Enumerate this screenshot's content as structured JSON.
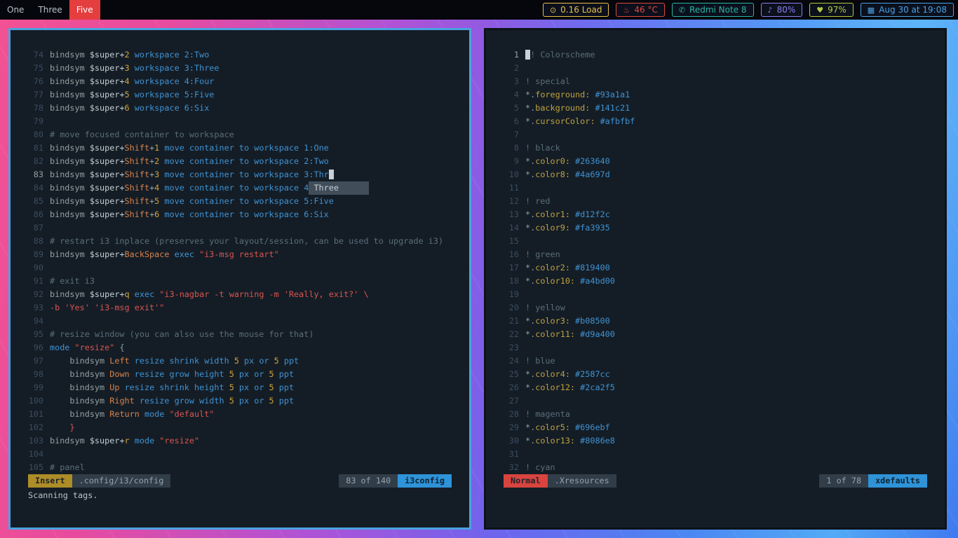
{
  "bar": {
    "workspaces": [
      {
        "label": "One",
        "active": false
      },
      {
        "label": "Three",
        "active": false
      },
      {
        "label": "Five",
        "active": true
      }
    ],
    "modules": [
      {
        "name": "load",
        "icon": "⊙",
        "label": "0.16 Load",
        "color": "#e8c04a"
      },
      {
        "name": "temp",
        "icon": "♨",
        "label": "46 °C",
        "color": "#e0473f"
      },
      {
        "name": "device",
        "icon": "✆",
        "label": "Redmi Note 8",
        "color": "#2ab5a5"
      },
      {
        "name": "volume",
        "icon": "♪",
        "label": "80%",
        "color": "#8b7ff0"
      },
      {
        "name": "battery",
        "icon": "♥",
        "label": "97%",
        "color": "#b5cb3f"
      },
      {
        "name": "date",
        "icon": "▦",
        "label": "Aug 30 at 19:08",
        "color": "#4aa3e8"
      }
    ]
  },
  "left_editor": {
    "statusline": {
      "mode": "Insert",
      "file": ".config/i3/config",
      "position": "83 of 140",
      "filetype": "i3config"
    },
    "cmdline": "Scanning tags.",
    "current_line": 83,
    "completion_popup": "Three",
    "lines": [
      {
        "n": 74,
        "t": [
          [
            "f",
            "bindsym "
          ],
          [
            "v",
            "$super+"
          ],
          [
            "n",
            "2"
          ],
          [
            "f",
            " "
          ],
          [
            "k",
            "workspace 2:Two"
          ]
        ]
      },
      {
        "n": 75,
        "t": [
          [
            "f",
            "bindsym "
          ],
          [
            "v",
            "$super+"
          ],
          [
            "n",
            "3"
          ],
          [
            "f",
            " "
          ],
          [
            "k",
            "workspace 3:Three"
          ]
        ]
      },
      {
        "n": 76,
        "t": [
          [
            "f",
            "bindsym "
          ],
          [
            "v",
            "$super+"
          ],
          [
            "n",
            "4"
          ],
          [
            "f",
            " "
          ],
          [
            "k",
            "workspace 4:Four"
          ]
        ]
      },
      {
        "n": 77,
        "t": [
          [
            "f",
            "bindsym "
          ],
          [
            "v",
            "$super+"
          ],
          [
            "n",
            "5"
          ],
          [
            "f",
            " "
          ],
          [
            "k",
            "workspace 5:Five"
          ]
        ]
      },
      {
        "n": 78,
        "t": [
          [
            "f",
            "bindsym "
          ],
          [
            "v",
            "$super+"
          ],
          [
            "n",
            "6"
          ],
          [
            "f",
            " "
          ],
          [
            "k",
            "workspace 6:Six"
          ]
        ]
      },
      {
        "n": 79,
        "t": []
      },
      {
        "n": 80,
        "t": [
          [
            "c",
            "# move focused container to workspace"
          ]
        ]
      },
      {
        "n": 81,
        "t": [
          [
            "f",
            "bindsym "
          ],
          [
            "v",
            "$super+"
          ],
          [
            "e",
            "Shift"
          ],
          [
            "f",
            "+"
          ],
          [
            "n",
            "1"
          ],
          [
            "f",
            " "
          ],
          [
            "k",
            "move container to workspace 1:One"
          ]
        ]
      },
      {
        "n": 82,
        "t": [
          [
            "f",
            "bindsym "
          ],
          [
            "v",
            "$super+"
          ],
          [
            "e",
            "Shift"
          ],
          [
            "f",
            "+"
          ],
          [
            "n",
            "2"
          ],
          [
            "f",
            " "
          ],
          [
            "k",
            "move container to workspace 2:Two"
          ]
        ]
      },
      {
        "n": 83,
        "t": [
          [
            "f",
            "bindsym "
          ],
          [
            "v",
            "$super+"
          ],
          [
            "e",
            "Shift"
          ],
          [
            "f",
            "+"
          ],
          [
            "n",
            "3"
          ],
          [
            "f",
            " "
          ],
          [
            "k",
            "move container to workspace 3:Thr"
          ],
          [
            "C",
            " "
          ]
        ]
      },
      {
        "n": 84,
        "t": [
          [
            "f",
            "bindsym "
          ],
          [
            "v",
            "$super+"
          ],
          [
            "e",
            "Shift"
          ],
          [
            "f",
            "+"
          ],
          [
            "n",
            "4"
          ],
          [
            "f",
            " "
          ],
          [
            "k",
            "move container to workspace 4"
          ],
          [
            "P",
            "Three"
          ]
        ]
      },
      {
        "n": 85,
        "t": [
          [
            "f",
            "bindsym "
          ],
          [
            "v",
            "$super+"
          ],
          [
            "e",
            "Shift"
          ],
          [
            "f",
            "+"
          ],
          [
            "n",
            "5"
          ],
          [
            "f",
            " "
          ],
          [
            "k",
            "move container to workspace 5:Five"
          ]
        ]
      },
      {
        "n": 86,
        "t": [
          [
            "f",
            "bindsym "
          ],
          [
            "v",
            "$super+"
          ],
          [
            "e",
            "Shift"
          ],
          [
            "f",
            "+"
          ],
          [
            "n",
            "6"
          ],
          [
            "f",
            " "
          ],
          [
            "k",
            "move container to workspace 6:Six"
          ]
        ]
      },
      {
        "n": 87,
        "t": []
      },
      {
        "n": 88,
        "t": [
          [
            "c",
            "# restart i3 inplace (preserves your layout/session, can be used to upgrade i3)"
          ]
        ]
      },
      {
        "n": 89,
        "t": [
          [
            "f",
            "bindsym "
          ],
          [
            "v",
            "$super+"
          ],
          [
            "e",
            "BackSpace"
          ],
          [
            "f",
            " "
          ],
          [
            "k",
            "exec "
          ],
          [
            "s",
            "\"i3-msg restart\""
          ]
        ]
      },
      {
        "n": 90,
        "t": []
      },
      {
        "n": 91,
        "t": [
          [
            "c",
            "# exit i3"
          ]
        ]
      },
      {
        "n": 92,
        "t": [
          [
            "f",
            "bindsym "
          ],
          [
            "v",
            "$super+"
          ],
          [
            "n",
            "q"
          ],
          [
            "f",
            " "
          ],
          [
            "k",
            "exec "
          ],
          [
            "s",
            "\"i3-nagbar -t warning -m 'Really, exit?' \\"
          ]
        ]
      },
      {
        "n": 93,
        "t": [
          [
            "s",
            "-b 'Yes' 'i3-msg exit'\""
          ]
        ]
      },
      {
        "n": 94,
        "t": []
      },
      {
        "n": 95,
        "t": [
          [
            "c",
            "# resize window (you can also use the mouse for that)"
          ]
        ]
      },
      {
        "n": 96,
        "t": [
          [
            "k",
            "mode "
          ],
          [
            "s",
            "\"resize\""
          ],
          [
            "f",
            " {"
          ]
        ]
      },
      {
        "n": 97,
        "t": [
          [
            "f",
            "    bindsym "
          ],
          [
            "e",
            "Left"
          ],
          [
            "f",
            " "
          ],
          [
            "k",
            "resize shrink width "
          ],
          [
            "n",
            "5"
          ],
          [
            "k",
            " px or "
          ],
          [
            "n",
            "5"
          ],
          [
            "k",
            " ppt"
          ]
        ]
      },
      {
        "n": 98,
        "t": [
          [
            "f",
            "    bindsym "
          ],
          [
            "e",
            "Down"
          ],
          [
            "f",
            " "
          ],
          [
            "k",
            "resize grow height "
          ],
          [
            "n",
            "5"
          ],
          [
            "k",
            " px or "
          ],
          [
            "n",
            "5"
          ],
          [
            "k",
            " ppt"
          ]
        ]
      },
      {
        "n": 99,
        "t": [
          [
            "f",
            "    bindsym "
          ],
          [
            "e",
            "Up"
          ],
          [
            "f",
            " "
          ],
          [
            "k",
            "resize shrink height "
          ],
          [
            "n",
            "5"
          ],
          [
            "k",
            " px or "
          ],
          [
            "n",
            "5"
          ],
          [
            "k",
            " ppt"
          ]
        ]
      },
      {
        "n": 100,
        "t": [
          [
            "f",
            "    bindsym "
          ],
          [
            "e",
            "Right"
          ],
          [
            "f",
            " "
          ],
          [
            "k",
            "resize grow width "
          ],
          [
            "n",
            "5"
          ],
          [
            "k",
            " px or "
          ],
          [
            "n",
            "5"
          ],
          [
            "k",
            " ppt"
          ]
        ]
      },
      {
        "n": 101,
        "t": [
          [
            "f",
            "    bindsym "
          ],
          [
            "e",
            "Return"
          ],
          [
            "f",
            " "
          ],
          [
            "k",
            "mode "
          ],
          [
            "s",
            "\"default\""
          ]
        ]
      },
      {
        "n": 102,
        "t": [
          [
            "s",
            "    }"
          ]
        ]
      },
      {
        "n": 103,
        "t": [
          [
            "f",
            "bindsym "
          ],
          [
            "v",
            "$super+"
          ],
          [
            "n",
            "r"
          ],
          [
            "f",
            " "
          ],
          [
            "k",
            "mode "
          ],
          [
            "s",
            "\"resize\""
          ]
        ]
      },
      {
        "n": 104,
        "t": []
      },
      {
        "n": 105,
        "t": [
          [
            "c",
            "# panel"
          ]
        ]
      }
    ]
  },
  "right_editor": {
    "statusline": {
      "mode": "Normal",
      "file": ".Xresources",
      "position": "1 of 78",
      "filetype": "xdefaults"
    },
    "cmdline": "",
    "current_line": 1,
    "lines": [
      {
        "n": 1,
        "t": [
          [
            "C",
            " "
          ],
          [
            "c",
            "! Colorscheme"
          ]
        ]
      },
      {
        "n": 2,
        "t": []
      },
      {
        "n": 3,
        "t": [
          [
            "c",
            "! special"
          ]
        ]
      },
      {
        "n": 4,
        "t": [
          [
            "f",
            "*."
          ],
          [
            "N",
            "foreground:"
          ],
          [
            "f",
            " "
          ],
          [
            "V",
            "#93a1a1"
          ]
        ]
      },
      {
        "n": 5,
        "t": [
          [
            "f",
            "*."
          ],
          [
            "N",
            "background:"
          ],
          [
            "f",
            " "
          ],
          [
            "V",
            "#141c21"
          ]
        ]
      },
      {
        "n": 6,
        "t": [
          [
            "f",
            "*."
          ],
          [
            "N",
            "cursorColor:"
          ],
          [
            "f",
            " "
          ],
          [
            "V",
            "#afbfbf"
          ]
        ]
      },
      {
        "n": 7,
        "t": []
      },
      {
        "n": 8,
        "t": [
          [
            "c",
            "! black"
          ]
        ]
      },
      {
        "n": 9,
        "t": [
          [
            "f",
            "*."
          ],
          [
            "N",
            "color0:"
          ],
          [
            "f",
            " "
          ],
          [
            "V",
            "#263640"
          ]
        ]
      },
      {
        "n": 10,
        "t": [
          [
            "f",
            "*."
          ],
          [
            "N",
            "color8:"
          ],
          [
            "f",
            " "
          ],
          [
            "V",
            "#4a697d"
          ]
        ]
      },
      {
        "n": 11,
        "t": []
      },
      {
        "n": 12,
        "t": [
          [
            "c",
            "! red"
          ]
        ]
      },
      {
        "n": 13,
        "t": [
          [
            "f",
            "*."
          ],
          [
            "N",
            "color1:"
          ],
          [
            "f",
            " "
          ],
          [
            "V",
            "#d12f2c"
          ]
        ]
      },
      {
        "n": 14,
        "t": [
          [
            "f",
            "*."
          ],
          [
            "N",
            "color9:"
          ],
          [
            "f",
            " "
          ],
          [
            "V",
            "#fa3935"
          ]
        ]
      },
      {
        "n": 15,
        "t": []
      },
      {
        "n": 16,
        "t": [
          [
            "c",
            "! green"
          ]
        ]
      },
      {
        "n": 17,
        "t": [
          [
            "f",
            "*."
          ],
          [
            "N",
            "color2:"
          ],
          [
            "f",
            " "
          ],
          [
            "V",
            "#819400"
          ]
        ]
      },
      {
        "n": 18,
        "t": [
          [
            "f",
            "*."
          ],
          [
            "N",
            "color10:"
          ],
          [
            "f",
            " "
          ],
          [
            "V",
            "#a4bd00"
          ]
        ]
      },
      {
        "n": 19,
        "t": []
      },
      {
        "n": 20,
        "t": [
          [
            "c",
            "! yellow"
          ]
        ]
      },
      {
        "n": 21,
        "t": [
          [
            "f",
            "*."
          ],
          [
            "N",
            "color3:"
          ],
          [
            "f",
            " "
          ],
          [
            "V",
            "#b08500"
          ]
        ]
      },
      {
        "n": 22,
        "t": [
          [
            "f",
            "*."
          ],
          [
            "N",
            "color11:"
          ],
          [
            "f",
            " "
          ],
          [
            "V",
            "#d9a400"
          ]
        ]
      },
      {
        "n": 23,
        "t": []
      },
      {
        "n": 24,
        "t": [
          [
            "c",
            "! blue"
          ]
        ]
      },
      {
        "n": 25,
        "t": [
          [
            "f",
            "*."
          ],
          [
            "N",
            "color4:"
          ],
          [
            "f",
            " "
          ],
          [
            "V",
            "#2587cc"
          ]
        ]
      },
      {
        "n": 26,
        "t": [
          [
            "f",
            "*."
          ],
          [
            "N",
            "color12:"
          ],
          [
            "f",
            " "
          ],
          [
            "V",
            "#2ca2f5"
          ]
        ]
      },
      {
        "n": 27,
        "t": []
      },
      {
        "n": 28,
        "t": [
          [
            "c",
            "! magenta"
          ]
        ]
      },
      {
        "n": 29,
        "t": [
          [
            "f",
            "*."
          ],
          [
            "N",
            "color5:"
          ],
          [
            "f",
            " "
          ],
          [
            "V",
            "#696ebf"
          ]
        ]
      },
      {
        "n": 30,
        "t": [
          [
            "f",
            "*."
          ],
          [
            "N",
            "color13:"
          ],
          [
            "f",
            " "
          ],
          [
            "V",
            "#8086e8"
          ]
        ]
      },
      {
        "n": 31,
        "t": []
      },
      {
        "n": 32,
        "t": [
          [
            "c",
            "! cyan"
          ]
        ]
      }
    ]
  }
}
